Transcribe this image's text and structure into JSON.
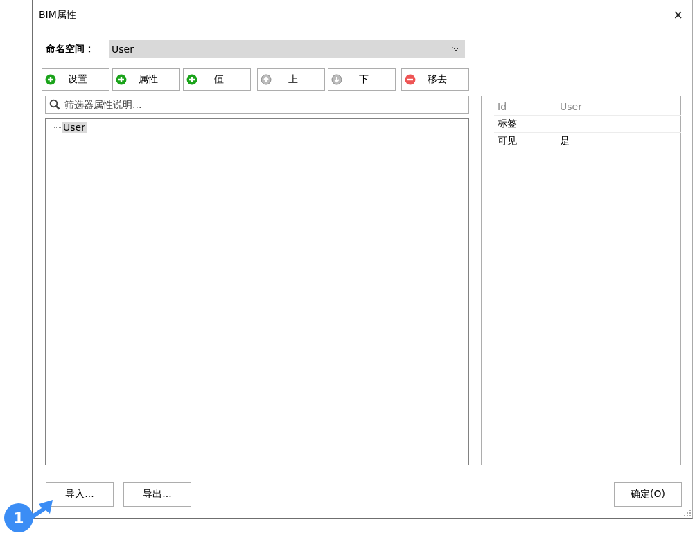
{
  "window": {
    "title": "BIM属性",
    "close": "×"
  },
  "namespace": {
    "label": "命名空间：",
    "value": "User"
  },
  "toolbar": [
    {
      "label": "设置",
      "kind": "add"
    },
    {
      "label": "属性",
      "kind": "add"
    },
    {
      "label": "值",
      "kind": "add"
    },
    {
      "label": "上",
      "kind": "up"
    },
    {
      "label": "下",
      "kind": "down"
    },
    {
      "label": "移去",
      "kind": "remove"
    }
  ],
  "search": {
    "placeholder": "筛选器属性说明..."
  },
  "tree": [
    {
      "label": "User",
      "selected": true
    }
  ],
  "properties": {
    "columns": [
      "Id",
      "User"
    ],
    "rows": [
      [
        "标签",
        ""
      ],
      [
        "可见",
        "是"
      ]
    ]
  },
  "footer": {
    "left_buttons": [
      "导入...",
      "导出..."
    ],
    "ok_button": "确定(O)"
  },
  "callout": {
    "label": "1"
  }
}
